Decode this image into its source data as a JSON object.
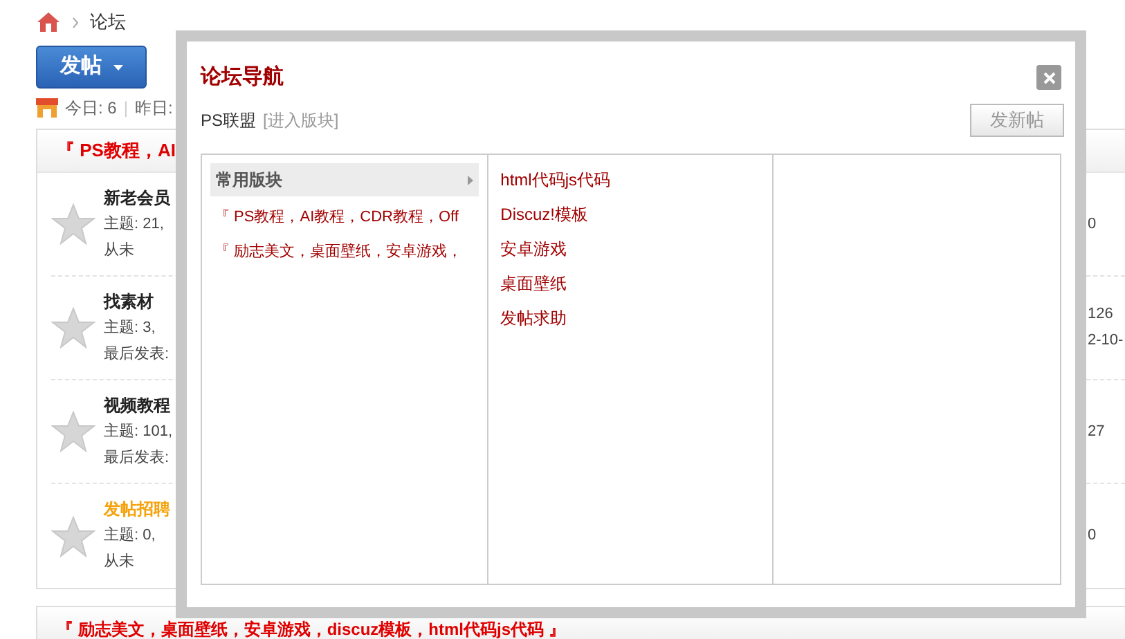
{
  "breadcrumb": {
    "items": [
      "论坛"
    ]
  },
  "post_button": {
    "label": "发帖"
  },
  "stats": [
    "今日: 6",
    "昨日:"
  ],
  "stats_separator": "|",
  "forum_groups": [
    {
      "header": "『 PS教程，AI",
      "forums": [
        {
          "title": "新老会员",
          "color": "#222222",
          "lines": [
            "主题: 21,",
            "从未"
          ],
          "right_lines": [
            "0"
          ]
        },
        {
          "title": "找素材",
          "color": "#222222",
          "lines": [
            "主题: 3,",
            "最后发表:"
          ],
          "right_lines": [
            "126",
            "2-10-"
          ]
        },
        {
          "title": "视频教程",
          "color": "#222222",
          "lines": [
            "主题: 101,",
            "最后发表:"
          ],
          "right_lines": [
            "27"
          ]
        },
        {
          "title": "发帖招聘",
          "color": "#f5a30c",
          "lines": [
            "主题: 0,",
            "从未"
          ],
          "right_lines": [
            "0"
          ]
        }
      ]
    },
    {
      "header": "『 励志美文，桌面壁纸，安卓游戏，discuz模板，html代码js代码 』"
    }
  ],
  "modal": {
    "title": "论坛导航",
    "forum_name": "PS联盟",
    "enter_link": "[进入版块]",
    "new_post_button": "发新帖",
    "columns": [
      {
        "header": "常用版块",
        "items": [
          "『 PS教程，AI教程，CDR教程，Off",
          "『 励志美文，桌面壁纸，安卓游戏，"
        ]
      },
      {
        "items": [
          "html代码js代码",
          "Discuz!模板",
          "安卓游戏",
          "桌面壁纸",
          "发帖求助"
        ]
      }
    ]
  }
}
